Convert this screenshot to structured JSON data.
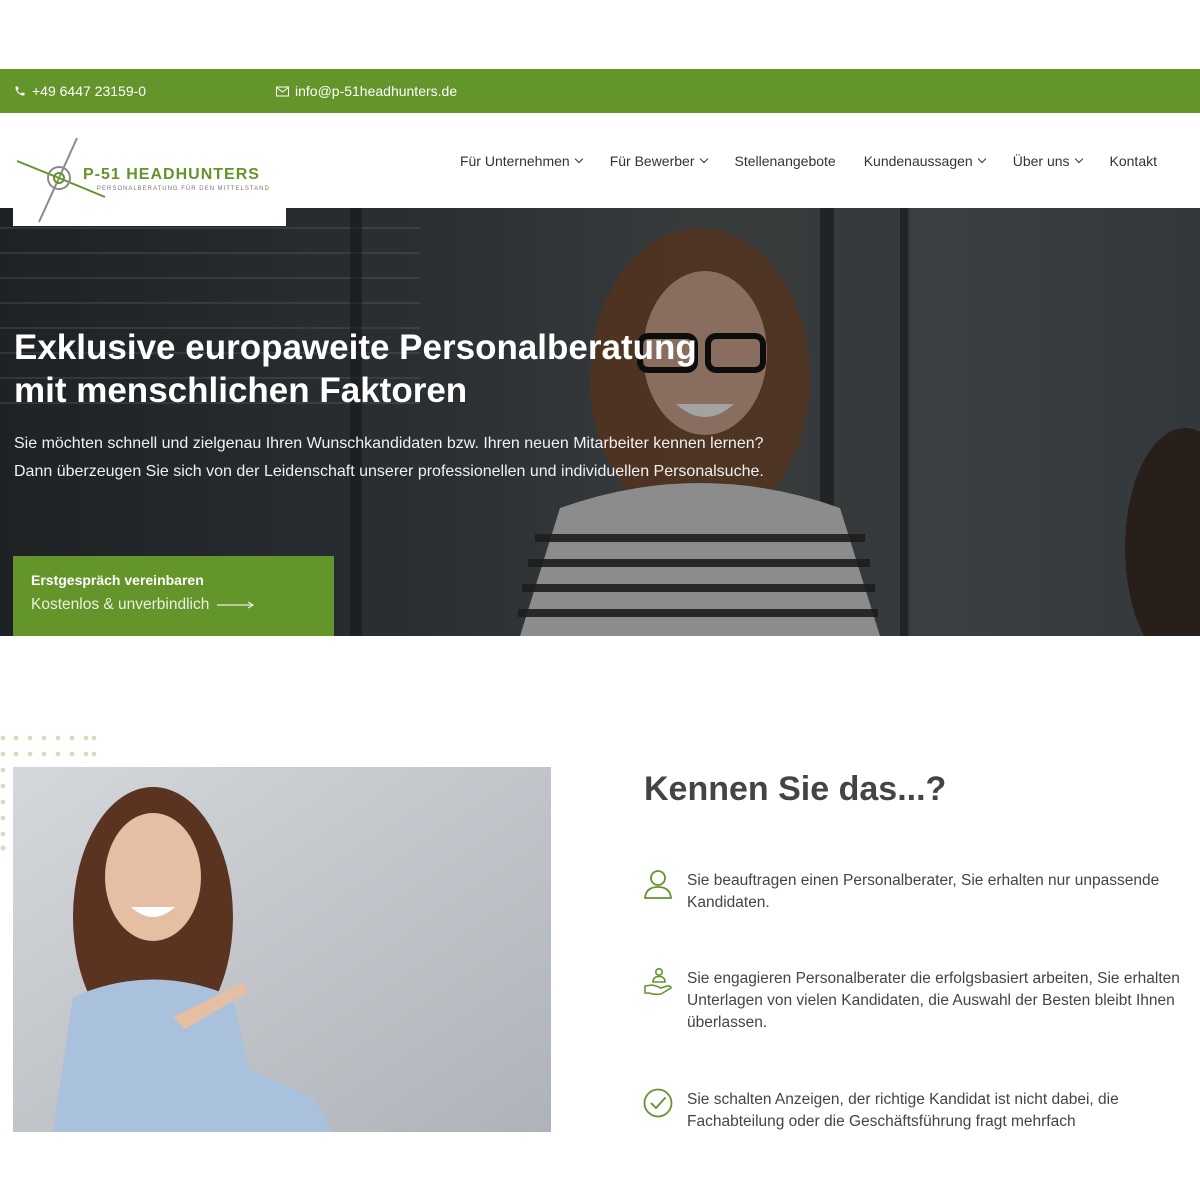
{
  "topbar": {
    "phone": "+49 6447 23159-0",
    "email": "info@p-51headhunters.de",
    "phone_icon": "phone-icon",
    "email_icon": "envelope-icon"
  },
  "logo": {
    "title": "P-51 HEADHUNTERS",
    "subtitle": "PERSONALBERATUNG FÜR DEN MITTELSTAND"
  },
  "nav": {
    "items": [
      {
        "label": "Für Unternehmen",
        "dropdown": true
      },
      {
        "label": "Für Bewerber",
        "dropdown": true
      },
      {
        "label": "Stellenangebote",
        "dropdown": false
      },
      {
        "label": "Kundenaussagen",
        "dropdown": true
      },
      {
        "label": "Über uns",
        "dropdown": true
      },
      {
        "label": "Kontakt",
        "dropdown": false
      }
    ]
  },
  "hero": {
    "title_line1": "Exklusive europaweite Personalberatung",
    "title_line2": "mit menschlichen Faktoren",
    "text": "Sie möchten schnell und zielgenau Ihren Wunschkandidaten bzw. Ihren neuen Mitarbeiter kennen lernen? Dann überzeugen Sie sich von der Leidenschaft unserer professionellen und individuellen Personalsuche.",
    "cta_line1": "Erstgespräch vereinbaren",
    "cta_line2": "Kostenlos & unverbindlich"
  },
  "section": {
    "title": "Kennen Sie das...?",
    "points": [
      {
        "icon": "person-icon",
        "text": "Sie beauftragen einen Personalberater, Sie erhalten nur unpassende Kandidaten."
      },
      {
        "icon": "hand-with-person-icon",
        "text": "Sie engagieren Personalberater die erfolgsbasiert arbeiten, Sie erhalten Unterlagen von vielen Kandidaten, die Auswahl der Besten bleibt Ihnen überlassen."
      },
      {
        "icon": "check-circle-icon",
        "text": "Sie schalten Anzeigen, der richtige Kandidat ist nicht dabei, die Fachabteilung oder die Geschäftsführung fragt mehrfach"
      }
    ]
  },
  "colors": {
    "accent": "#63952b",
    "text": "#444444"
  }
}
